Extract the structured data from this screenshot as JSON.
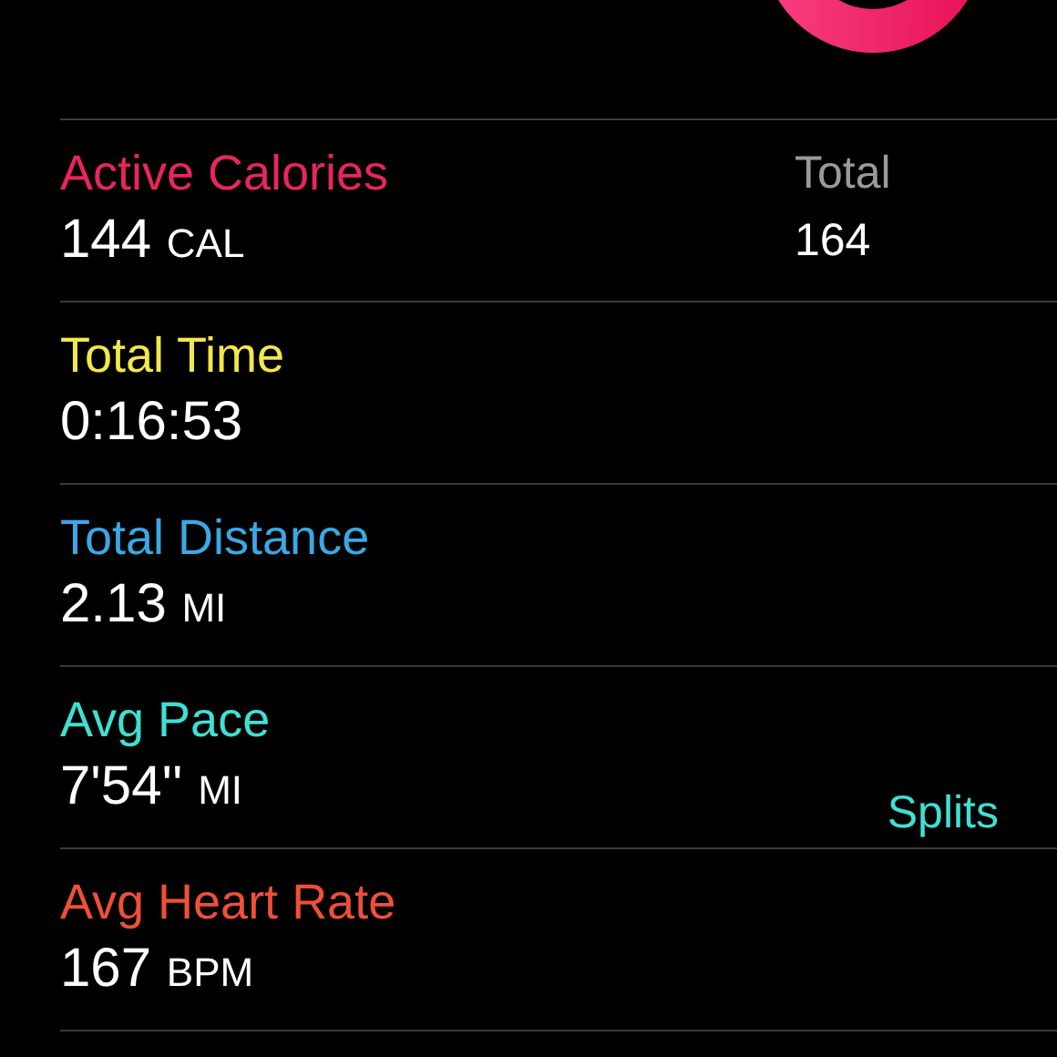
{
  "metrics": [
    {
      "label": "Active Calories",
      "value": "144",
      "unit": "CAL",
      "color": "#e8265a",
      "side": {
        "kind": "stat",
        "label": "Total",
        "value": "164"
      }
    },
    {
      "label": "Total Time",
      "value": "0:16:53",
      "color": "#f3e74b"
    },
    {
      "label": "Total Distance",
      "value": "2.13",
      "unit": "MI",
      "color": "#3ba8e4"
    },
    {
      "label": "Avg Pace",
      "value": "7'54''",
      "unit": "MI",
      "color": "#3fe0d2",
      "side": {
        "kind": "link",
        "label": "Splits"
      }
    },
    {
      "label": "Avg Heart Rate",
      "value": "167",
      "unit": "BPM",
      "color": "#ef4f38"
    }
  ]
}
